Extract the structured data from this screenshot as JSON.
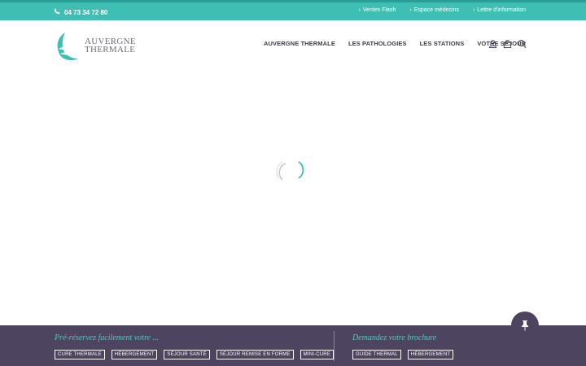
{
  "topbar": {
    "phone": "04 73 34 72 80",
    "links": [
      "Ventes Flash",
      "Espace médecins",
      "Lettre d'information"
    ]
  },
  "logo": {
    "line1": "AUVERGNE",
    "line2": "THERMALE"
  },
  "nav": {
    "items": [
      "AUVERGNE THERMALE",
      "LES PATHOLOGIES",
      "LES STATIONS",
      "VOTRE SÉJOUR"
    ]
  },
  "icons": [
    "user-icon",
    "bag-icon",
    "search-icon",
    "pin-icon",
    "phone-icon"
  ],
  "footer": {
    "left_title": "Pré-réservez facilement votre ...",
    "left_buttons": [
      "CURE THERMALE",
      "HÉBERGEMENT",
      "SÉJOUR SANTÉ",
      "SÉJOUR REMISE EN FORME",
      "MINI-CURE"
    ],
    "right_title": "Demandez votre brochure",
    "right_buttons": [
      "GUIDE THERMAL",
      "HÉBERGEMENT"
    ]
  },
  "colors": {
    "teal": "#3fbfb3",
    "purple": "#4d4460",
    "nav_text": "#3f3a4e"
  }
}
